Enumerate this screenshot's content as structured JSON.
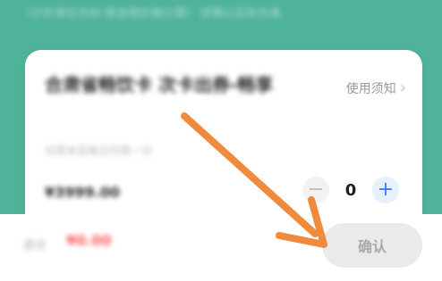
{
  "header": {
    "note": "（计价单位为份·按含税价格计算）· 详情以实际为准"
  },
  "card": {
    "product_title": "合肃省畅饮卡 次卡出券-畅享",
    "usage_notice_label": "使用须知",
    "usage_notice_icon": "chevron-right-icon",
    "product_sub": "仅限本店每日可用一次",
    "price": "¥3999.00"
  },
  "stepper": {
    "minus_label": "−",
    "quantity": "0",
    "plus_label": "+"
  },
  "footer": {
    "total_label": "合计",
    "total_amount": "¥0.00",
    "confirm_label": "确认"
  },
  "colors": {
    "teal_background": "#4fb39a",
    "accent_blue": "#3f7bf6",
    "price_red": "#ff5a5a",
    "arrow_orange": "#f08a3c"
  }
}
